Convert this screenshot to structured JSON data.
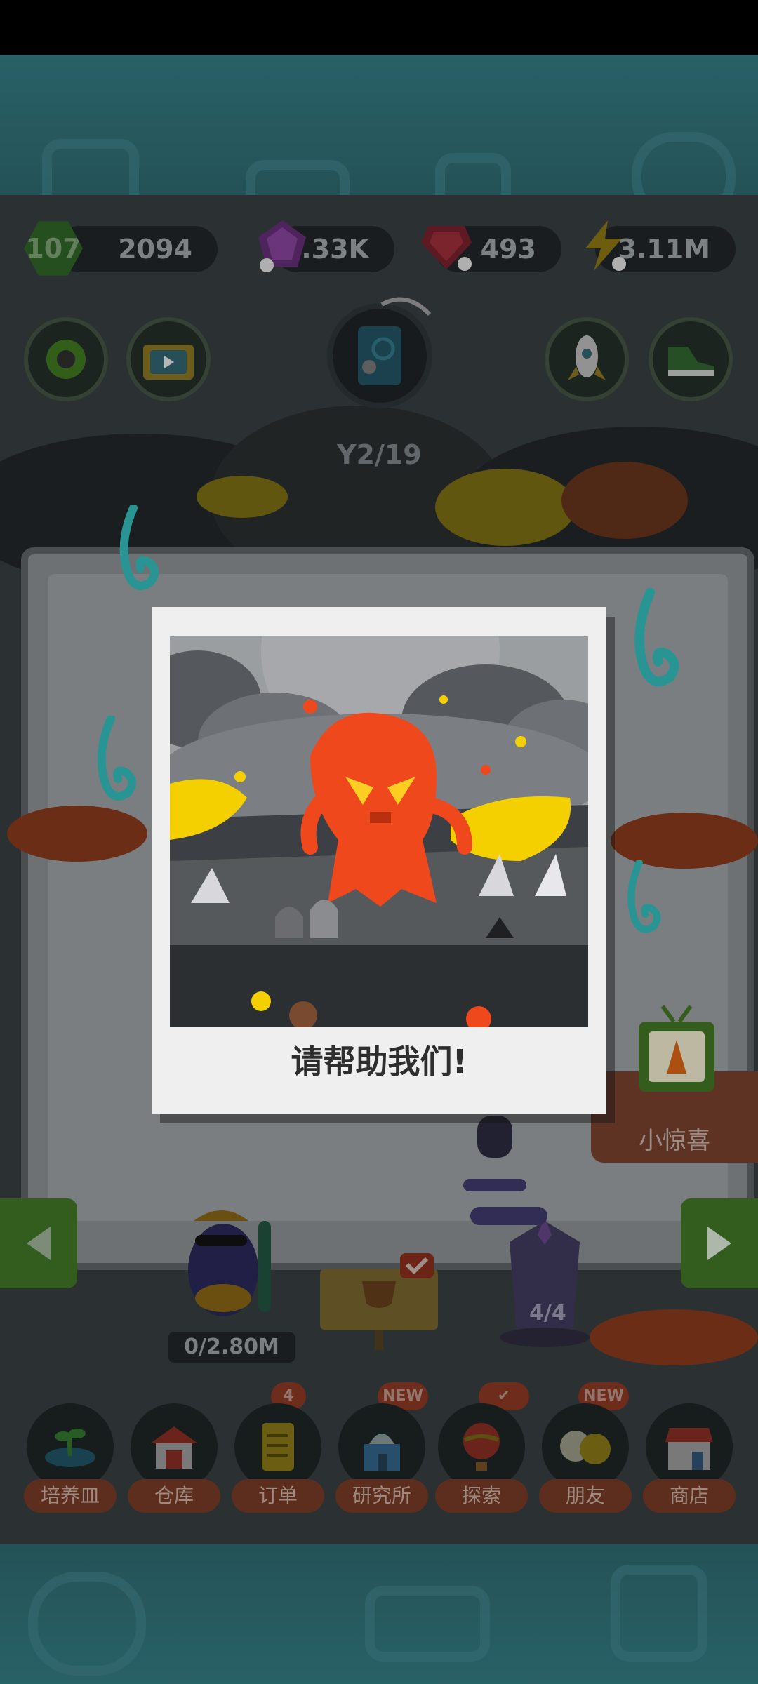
{
  "hud": {
    "level": "107",
    "dna": "2094",
    "purple_gems": "9.33K",
    "red_gems": "493",
    "energy": "3.11M"
  },
  "progress": "2/19",
  "planets": {
    "capacity": "0/2.80M",
    "slots": "4/4"
  },
  "surprise_label": "小惊喜",
  "popup": {
    "message": "请帮助我们!"
  },
  "nav": [
    {
      "label": "培养皿",
      "icon": "petri-dish-icon",
      "badge": ""
    },
    {
      "label": "仓库",
      "icon": "warehouse-icon",
      "badge": ""
    },
    {
      "label": "订单",
      "icon": "order-scroll-icon",
      "badge": "4"
    },
    {
      "label": "研究所",
      "icon": "lab-icon",
      "badge": "NEW"
    },
    {
      "label": "探索",
      "icon": "balloon-icon",
      "badge": "✔"
    },
    {
      "label": "朋友",
      "icon": "friends-icon",
      "badge": "NEW"
    },
    {
      "label": "商店",
      "icon": "shop-icon",
      "badge": ""
    }
  ],
  "colors": {
    "teal": "#2e6f76",
    "game_bg": "#31383a",
    "nav_label": "#6a3522",
    "fire_monster": "#f0481d",
    "lava_yellow": "#f4d000"
  }
}
